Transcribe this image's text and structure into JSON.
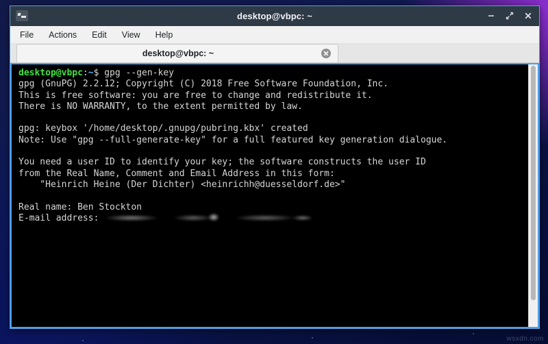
{
  "window": {
    "title": "desktop@vbpc: ~",
    "icon": "terminal-icon",
    "controls": {
      "minimize": "−",
      "maximize": "⤡",
      "close": "✕"
    }
  },
  "menubar": {
    "items": [
      {
        "label": "File"
      },
      {
        "label": "Actions"
      },
      {
        "label": "Edit"
      },
      {
        "label": "View"
      },
      {
        "label": "Help"
      }
    ]
  },
  "tabs": [
    {
      "label": "desktop@vbpc: ~",
      "close_icon": "close-icon",
      "active": true
    }
  ],
  "terminal": {
    "prompt": {
      "user_host": "desktop@vbpc",
      "colon": ":",
      "path": "~",
      "symbol": "$",
      "command": "gpg --gen-key"
    },
    "lines": [
      "gpg (GnuPG) 2.2.12; Copyright (C) 2018 Free Software Foundation, Inc.",
      "This is free software: you are free to change and redistribute it.",
      "There is NO WARRANTY, to the extent permitted by law.",
      "",
      "gpg: keybox '/home/desktop/.gnupg/pubring.kbx' created",
      "Note: Use \"gpg --full-generate-key\" for a full featured key generation dialogue.",
      "",
      "You need a user ID to identify your key; the software constructs the user ID",
      "from the Real Name, Comment and Email Address in this form:",
      "    \"Heinrich Heine (Der Dichter) <heinrichh@duesseldorf.de>\"",
      ""
    ],
    "real_name_prompt": "Real name: ",
    "real_name_value": "Ben Stockton",
    "email_prompt": "E-mail address: ",
    "email_value_redacted": true,
    "colors": {
      "background": "#000000",
      "foreground": "#d6d6d6",
      "prompt_user_host": "#3ee63e",
      "prompt_path": "#60b0f4",
      "border": "#4a9eeb"
    }
  },
  "desktop": {
    "watermark": "wsxdn.com"
  }
}
